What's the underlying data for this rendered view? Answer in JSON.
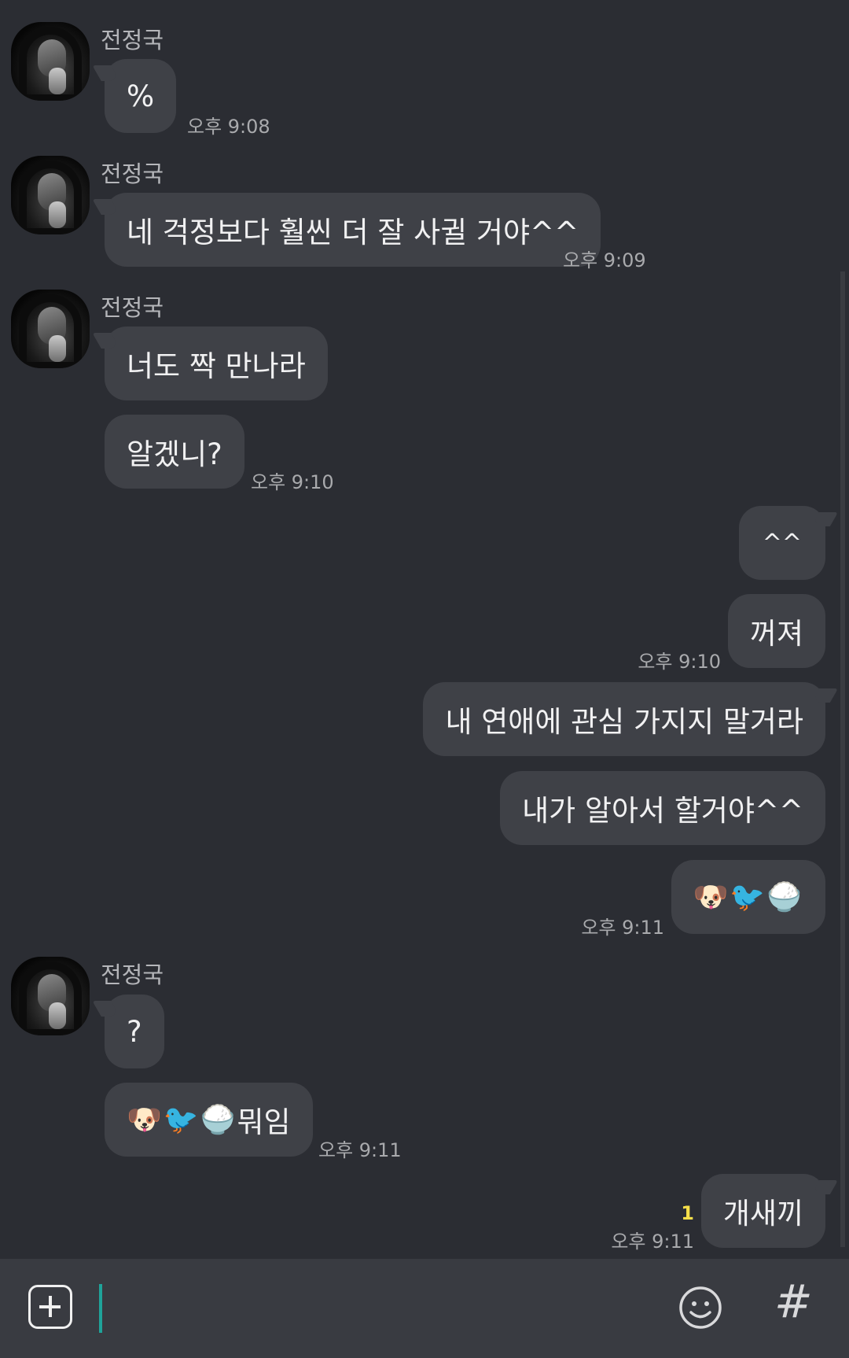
{
  "contact": {
    "name": "전정국"
  },
  "messages": {
    "m1": {
      "text": "%",
      "time": "오후 9:08"
    },
    "m2": {
      "text": "네 걱정보다 훨씬 더 잘 사귈 거야^^",
      "time": "오후 9:09"
    },
    "m3": {
      "text": "너도 짝 만나라"
    },
    "m4": {
      "text": "알겠니?",
      "time": "오후 9:10"
    },
    "m5": {
      "text": "^^"
    },
    "m6": {
      "text": "꺼져",
      "time": "오후 9:10"
    },
    "m7": {
      "text": "내 연애에 관심 가지지 말거라"
    },
    "m8": {
      "text": "내가 알아서 할거야^^"
    },
    "m9": {
      "emojis": [
        "🐶",
        "🐦",
        "🍚"
      ],
      "time": "오후 9:11"
    },
    "m10": {
      "text": "?"
    },
    "m11": {
      "emojis": [
        "🐶",
        "🐦",
        "🍚"
      ],
      "text": "뭐임",
      "time": "오후 9:11"
    },
    "m12": {
      "text": "개새끼",
      "unread": "1",
      "time": "오후 9:11"
    }
  },
  "composer": {
    "plus_icon": "plus-square-icon",
    "emoji_icon": "smiley-icon",
    "hash_icon": "hash-icon",
    "hash_label": "#",
    "input_value": ""
  }
}
